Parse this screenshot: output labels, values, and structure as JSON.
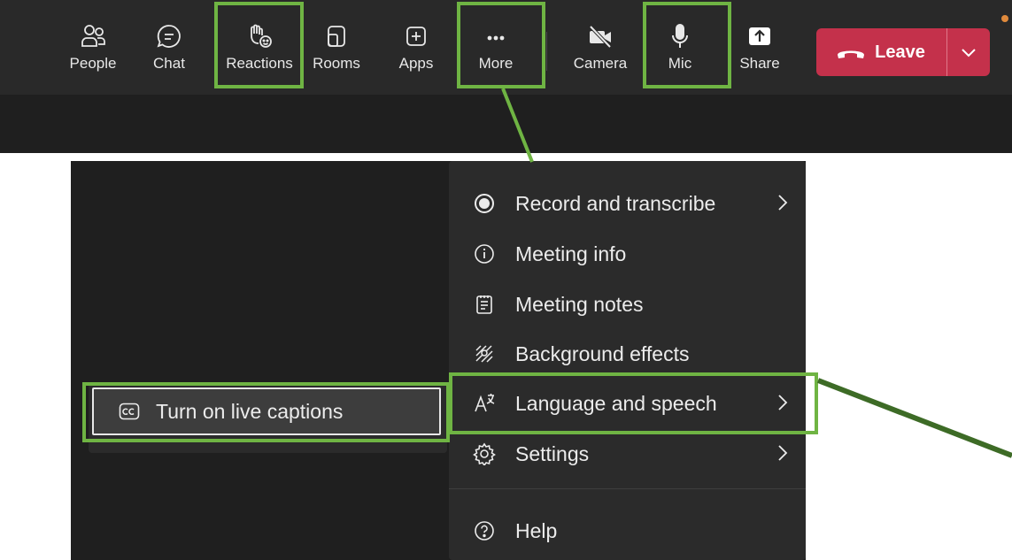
{
  "toolbar": {
    "buttons": [
      {
        "label": "People",
        "icon": "people-icon"
      },
      {
        "label": "Chat",
        "icon": "chat-icon"
      },
      {
        "label": "Reactions",
        "icon": "reactions-hand-icon"
      },
      {
        "label": "Rooms",
        "icon": "rooms-icon"
      },
      {
        "label": "Apps",
        "icon": "apps-plus-icon"
      },
      {
        "label": "More",
        "icon": "more-dots-icon"
      },
      {
        "label": "Camera",
        "icon": "camera-off-icon"
      },
      {
        "label": "Mic",
        "icon": "mic-icon"
      },
      {
        "label": "Share",
        "icon": "share-icon"
      }
    ],
    "leave_label": "Leave"
  },
  "more_menu": {
    "items": [
      {
        "label": "Record and transcribe",
        "icon": "record-icon",
        "has_submenu": true
      },
      {
        "label": "Meeting info",
        "icon": "info-icon",
        "has_submenu": false
      },
      {
        "label": "Meeting notes",
        "icon": "notes-icon",
        "has_submenu": false
      },
      {
        "label": "Background effects",
        "icon": "background-effects-icon",
        "has_submenu": false
      },
      {
        "label": "Language and speech",
        "icon": "language-icon",
        "has_submenu": true
      },
      {
        "label": "Settings",
        "icon": "settings-gear-icon",
        "has_submenu": true
      },
      {
        "label": "Help",
        "icon": "help-icon",
        "has_submenu": false
      }
    ]
  },
  "submenu": {
    "item_label": "Turn on live captions",
    "icon": "closed-captions-icon"
  },
  "colors": {
    "toolbar_bg": "#292929",
    "menu_bg": "#2b2b2b",
    "leave_red": "#c4314b",
    "highlight_green": "#6fb443",
    "callout_green": "#3d6b26"
  }
}
